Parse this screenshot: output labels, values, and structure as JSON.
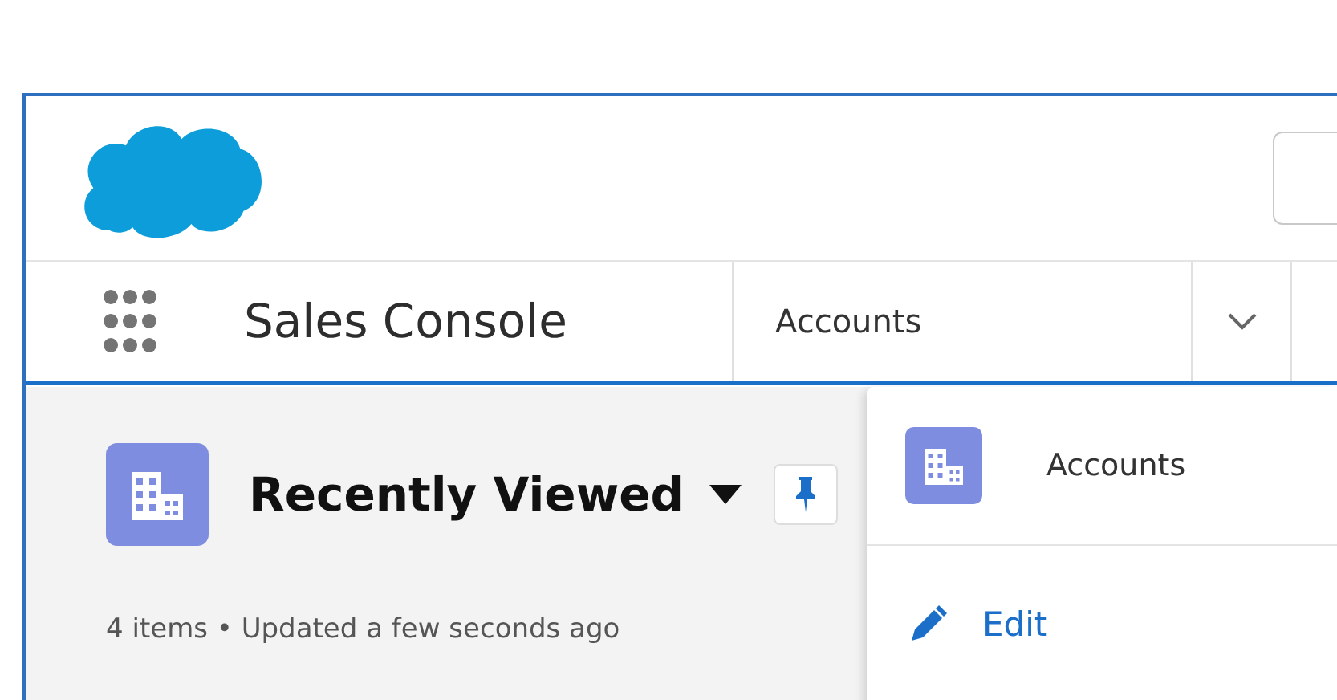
{
  "app": {
    "name": "Sales Console"
  },
  "nav_tab": {
    "label": "Accounts"
  },
  "list_view": {
    "title": "Recently Viewed",
    "subtitle": "4 items • Updated a few seconds ago"
  },
  "menu": [
    {
      "kind": "object",
      "label": "Accounts"
    },
    {
      "kind": "action",
      "label": "Edit"
    }
  ]
}
